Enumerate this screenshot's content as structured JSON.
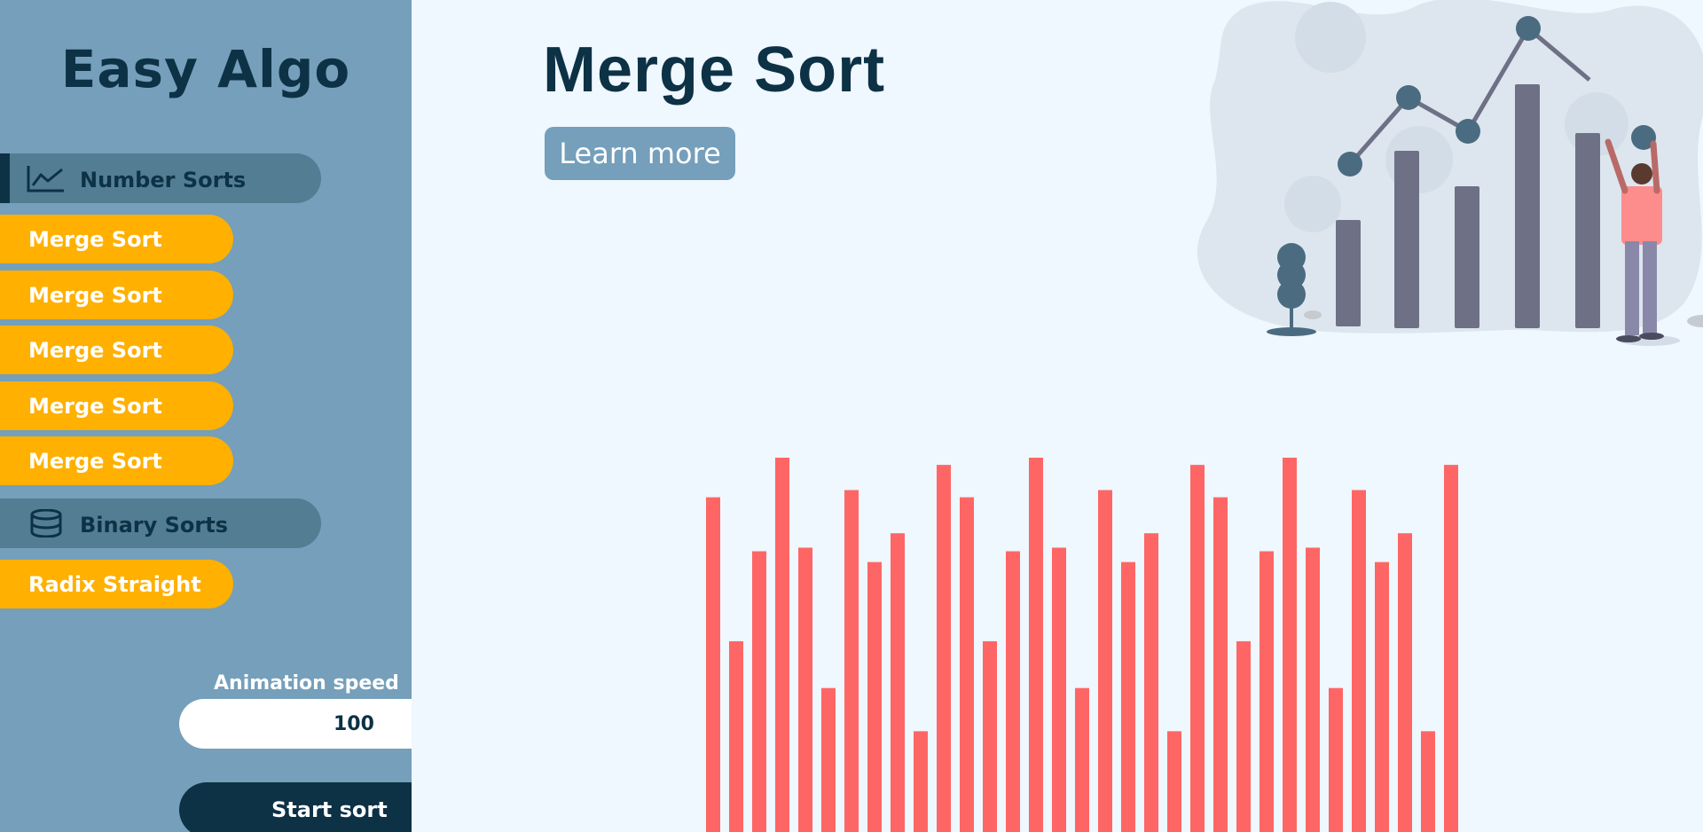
{
  "app": {
    "title": "Easy Algo"
  },
  "sidebar": {
    "categories": [
      {
        "label": "Number Sorts",
        "icon": "chart-line-icon",
        "active": true
      },
      {
        "label": "Binary Sorts",
        "icon": "database-icon",
        "active": false
      }
    ],
    "number_sorts": [
      {
        "label": "Merge Sort"
      },
      {
        "label": "Merge Sort"
      },
      {
        "label": "Merge Sort"
      },
      {
        "label": "Merge Sort"
      },
      {
        "label": "Merge Sort"
      }
    ],
    "binary_sorts": [
      {
        "label": "Radix Straight"
      }
    ],
    "speed": {
      "label": "Animation speed",
      "value": "100"
    },
    "start_label": "Start sort"
  },
  "main": {
    "title": "Merge Sort",
    "learn_more_label": "Learn more"
  },
  "colors": {
    "sidebar_bg": "#759fba",
    "category_bg": "#527d93",
    "navy": "#0d3145",
    "algo_item": "#ffb000",
    "bar": "#fe6665",
    "page_bg": "#eff7ff"
  },
  "chart_data": {
    "type": "bar",
    "values": [
      93,
      53,
      78,
      104,
      79,
      40,
      95,
      75,
      83,
      28,
      102,
      93,
      53,
      78,
      104,
      79,
      40,
      95,
      75,
      83,
      28,
      102,
      93,
      53,
      78,
      104,
      79,
      40,
      95,
      75,
      83,
      28,
      102
    ],
    "ylim": [
      0,
      104
    ]
  }
}
